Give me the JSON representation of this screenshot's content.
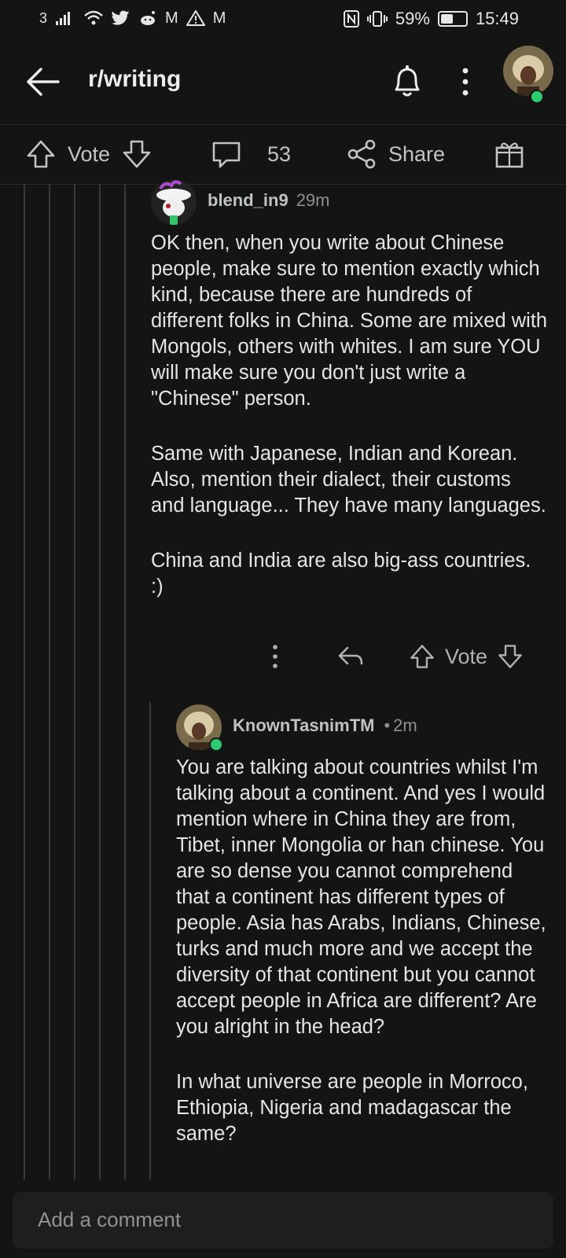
{
  "status_bar": {
    "sim_label": "3",
    "notif_icons": [
      "signal-icon",
      "wifi-icon",
      "twitter-icon",
      "reddit-icon",
      "gmail-icon",
      "warning-icon",
      "gmail-icon"
    ],
    "battery_percent": "59%",
    "battery_level": 0.59,
    "time": "15:49"
  },
  "header": {
    "title": "r/writing"
  },
  "action_bar": {
    "vote_label": "Vote",
    "comment_count": "53",
    "share_label": "Share"
  },
  "comments": [
    {
      "username": "blend_in9",
      "time": "29m",
      "paragraphs": [
        "OK then, when you write about Chinese people, make sure to mention exactly which kind, because there are hundreds of different folks in China. Some are mixed with Mongols, others with whites. I am sure YOU will make sure you don't just write a \"Chinese\" person.",
        "Same with Japanese, Indian and Korean. Also, mention their dialect, their customs and language... They have many languages.",
        "China and India are also big-ass countries. :)"
      ],
      "vote_label": "Vote"
    },
    {
      "username": "KnownTasnimTM",
      "separator": "•",
      "time": "2m",
      "paragraphs": [
        "You are talking about countries whilst I'm talking about a continent. And yes I would mention where in China they are from, Tibet, inner Mongolia or han chinese. You are so dense you cannot comprehend that a continent has different types of people. Asia has Arabs, Indians, Chinese, turks and much more and we accept the diversity of that continent but you cannot accept people in Africa are different? Are you alright in the head?",
        "In what universe are people in Morroco, Ethiopia, Nigeria and madagascar the same?"
      ]
    }
  ],
  "composer": {
    "placeholder": "Add a comment"
  },
  "colors": {
    "background": "#141414",
    "online": "#2ecc71",
    "text": "#e3e5e6",
    "muted": "#8c9093"
  }
}
